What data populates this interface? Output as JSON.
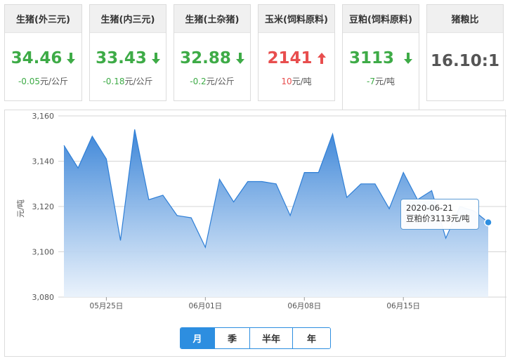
{
  "cards": [
    {
      "title": "生猪(外三元)",
      "price": "34.46",
      "trend": "down",
      "change_value": "-0.05",
      "change_unit": "元/公斤"
    },
    {
      "title": "生猪(内三元)",
      "price": "33.43",
      "trend": "down",
      "change_value": "-0.18",
      "change_unit": "元/公斤"
    },
    {
      "title": "生猪(土杂猪)",
      "price": "32.88",
      "trend": "down",
      "change_value": "-0.2",
      "change_unit": "元/公斤"
    },
    {
      "title": "玉米(饲料原料)",
      "price": "2141",
      "trend": "up",
      "change_value": "10",
      "change_unit": "元/吨"
    },
    {
      "title": "豆粕(饲料原料)",
      "price": "3113",
      "trend": "down",
      "change_value": "-7",
      "change_unit": "元/吨"
    },
    {
      "title": "猪粮比",
      "price": "16.10:1",
      "trend": "none"
    }
  ],
  "active_card": 4,
  "colors": {
    "down": "#3eab47",
    "up": "#e84e4e",
    "accent": "#2d8ee0",
    "area_top": "#3d86d8",
    "area_bottom": "#e8f1fb"
  },
  "chart_data": {
    "type": "area",
    "ylabel": "元/吨",
    "ylim": [
      3080,
      3160
    ],
    "yticks": [
      "3,160",
      "3,140",
      "3,120",
      "3,100",
      "3,080"
    ],
    "yticks_values": [
      3160,
      3140,
      3120,
      3100,
      3080
    ],
    "x_tick_labels": [
      "05月25日",
      "06月01日",
      "06月08日",
      "06月15日"
    ],
    "x_tick_dates": [
      "2020-05-25",
      "2020-06-01",
      "2020-06-08",
      "2020-06-15"
    ],
    "x_range": [
      "2020-05-22",
      "2020-06-21"
    ],
    "grid": true,
    "series": [
      {
        "x": [
          "2020-05-22",
          "2020-05-23",
          "2020-05-24",
          "2020-05-25",
          "2020-05-26",
          "2020-05-27",
          "2020-05-28",
          "2020-05-29",
          "2020-05-30",
          "2020-05-31",
          "2020-06-01",
          "2020-06-02",
          "2020-06-03",
          "2020-06-04",
          "2020-06-05",
          "2020-06-06",
          "2020-06-07",
          "2020-06-08",
          "2020-06-09",
          "2020-06-10",
          "2020-06-11",
          "2020-06-12",
          "2020-06-13",
          "2020-06-14",
          "2020-06-15",
          "2020-06-16",
          "2020-06-17",
          "2020-06-18",
          "2020-06-19",
          "2020-06-20",
          "2020-06-21"
        ],
        "values": [
          3147,
          3137,
          3151,
          3141,
          3105,
          3154,
          3123,
          3125,
          3116,
          3115,
          3102,
          3132,
          3122,
          3131,
          3131,
          3130,
          3116,
          3135,
          3135,
          3152,
          3124,
          3130,
          3130,
          3119,
          3135,
          3123,
          3127,
          3106,
          3120,
          3118,
          3113
        ]
      }
    ],
    "tooltip": {
      "date": "2020-06-21",
      "label": "豆粕价3113元/吨"
    }
  },
  "range_buttons": [
    "月",
    "季",
    "半年",
    "年"
  ],
  "active_range": 0
}
